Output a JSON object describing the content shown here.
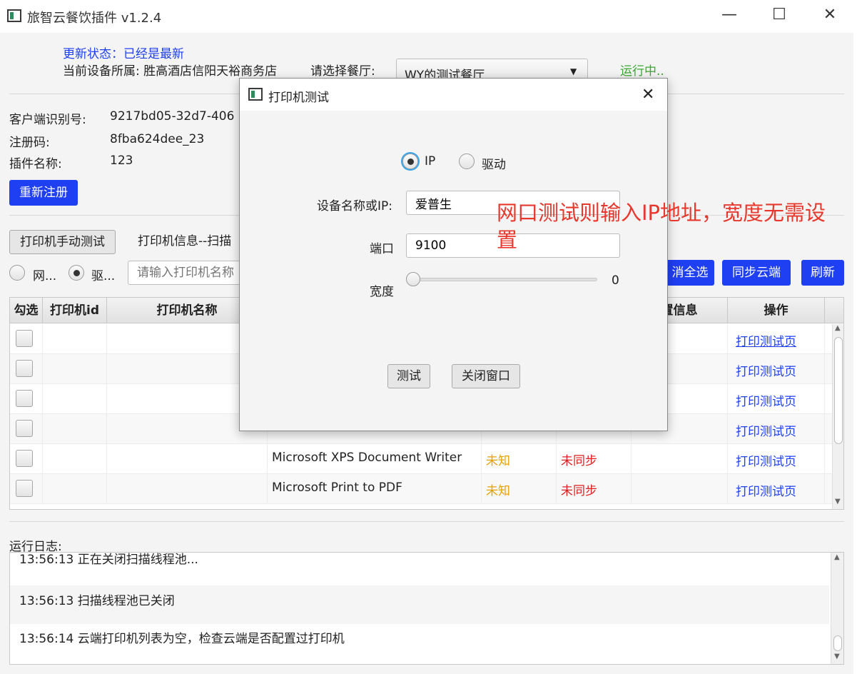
{
  "window": {
    "title": "旅智云餐饮插件 v1.2.4",
    "minimize": "—",
    "maximize": "☐",
    "close": "✕"
  },
  "header": {
    "update_status": "更新状态：已经是最新",
    "device_owner": "当前设备所属: 胜高酒店信阳天裕商务店",
    "restaurant_label": "请选择餐厅:",
    "restaurant_value": "WY的测试餐厅",
    "running_status": "运行中.."
  },
  "info": {
    "client_id_label": "客户端识别号:",
    "client_id_value": "9217bd05-32d7-406",
    "reg_code_label": "注册码:",
    "reg_code_value": "8fba624dee_23",
    "plugin_name_label": "插件名称:",
    "plugin_name_value": "123",
    "reregister_button": "重新注册"
  },
  "printer_bar": {
    "manual_test_button": "打印机手动测试",
    "printer_info_label": "打印机信息--扫描",
    "mode_network": "网...",
    "mode_driver": "驱...",
    "search_placeholder": "请输入打印机名称",
    "deselect_all_button": "消全选",
    "sync_cloud_button": "同步云端",
    "refresh_button": "刷新"
  },
  "table": {
    "headers": [
      "勾选",
      "打印机id",
      "打印机名称",
      "置信息",
      "操作"
    ],
    "rows": [
      {
        "name": "",
        "status": "",
        "sync": "",
        "action": "打印测试页"
      },
      {
        "name": "",
        "status": "",
        "sync": "",
        "action": "打印测试页"
      },
      {
        "name": "",
        "status": "",
        "sync": "",
        "action": "打印测试页"
      },
      {
        "name": "",
        "status": "",
        "sync": "",
        "action": "打印测试页"
      },
      {
        "name": "Microsoft XPS Document Writer",
        "status": "未知",
        "sync": "未同步",
        "action": "打印测试页"
      },
      {
        "name": "Microsoft Print to PDF",
        "status": "未知",
        "sync": "未同步",
        "action": "打印测试页"
      }
    ],
    "status_color": "#e6a100",
    "sync_color": "#e02020"
  },
  "log": {
    "label": "运行日志:",
    "lines": [
      "13:56:13 正在关闭扫描线程池...",
      "13:56:13 扫描线程池已关闭",
      "13:56:14 云端打印机列表为空，检查云端是否配置过打印机"
    ]
  },
  "dialog": {
    "title": "打印机测试",
    "close": "✕",
    "mode_ip": "IP",
    "mode_driver": "驱动",
    "device_label": "设备名称或IP:",
    "device_value": "爱普生",
    "port_label": "端口",
    "port_value": "9100",
    "width_label": "宽度",
    "width_value": "0",
    "test_button": "测试",
    "close_button": "关闭窗口"
  },
  "annotation": "网口测试则输入IP地址，宽度无需设置",
  "colors": {
    "accent_blue": "#1f3ff2",
    "running_green": "#3aa832",
    "annotation_red": "#e8382e"
  }
}
